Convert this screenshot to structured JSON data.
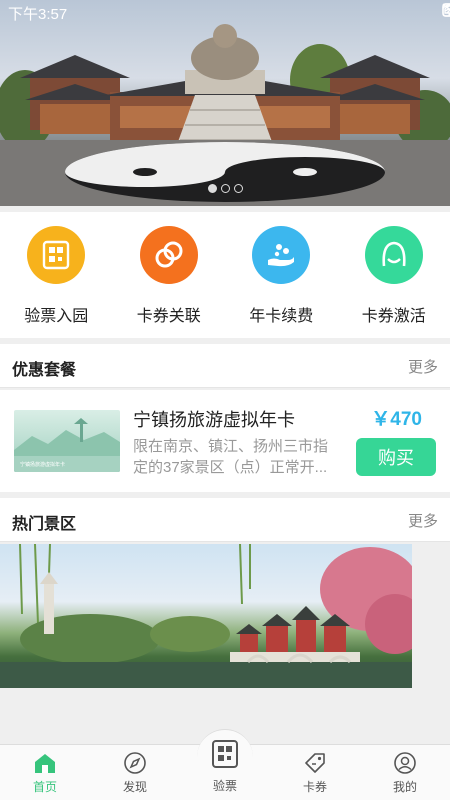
{
  "status_bar": {
    "time": "下午3:57"
  },
  "banner": {
    "dots": 3,
    "active_dot": 0
  },
  "actions": [
    {
      "label": "验票入园",
      "icon": "qr-ticket-icon",
      "color": "#f7b21c"
    },
    {
      "label": "卡券关联",
      "icon": "link-icon",
      "color": "#f4711e"
    },
    {
      "label": "年卡续费",
      "icon": "hand-coins-icon",
      "color": "#3cb7ee"
    },
    {
      "label": "卡券激活",
      "icon": "smile-face-icon",
      "color": "#35d99a"
    }
  ],
  "packages_section": {
    "title": "优惠套餐",
    "more": "更多"
  },
  "package": {
    "title": "宁镇扬旅游虚拟年卡",
    "description": "限在南京、镇江、扬州三市指定的37家景区（点）正常开...",
    "price": "￥470",
    "buy_label": "购买",
    "thumb_caption": "宁镇扬旅游虚拟年卡"
  },
  "scenic_section": {
    "title": "热门景区",
    "more": "更多"
  },
  "bottom_nav": [
    {
      "label": "首页",
      "icon": "home-icon",
      "active": true
    },
    {
      "label": "发现",
      "icon": "compass-icon",
      "active": false
    },
    {
      "label": "验票",
      "icon": "qr-ticket-icon",
      "active": false
    },
    {
      "label": "卡券",
      "icon": "coupon-tag-icon",
      "active": false
    },
    {
      "label": "我的",
      "icon": "user-icon",
      "active": false
    }
  ],
  "colors": {
    "accent": "#36d696",
    "price": "#2fb5e8",
    "nav_active": "#36c47c"
  }
}
